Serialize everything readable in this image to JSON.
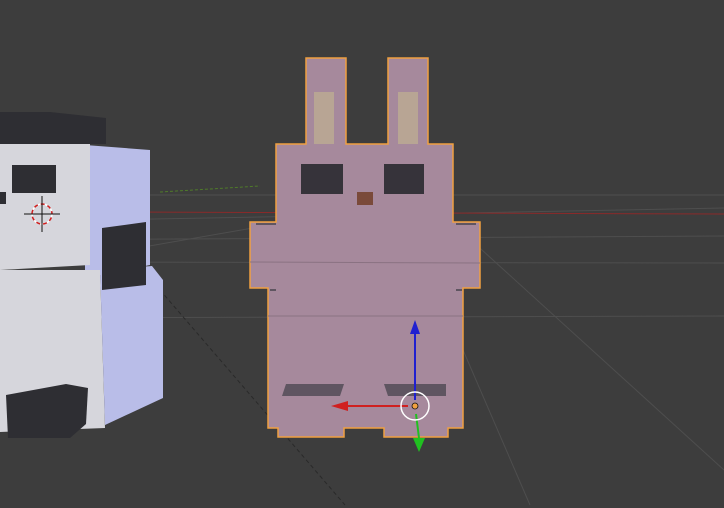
{
  "app": {
    "kind": "3d-viewport"
  },
  "viewport": {
    "background": "#3d3d3d",
    "grid_line_color": "#4e4e4e",
    "x_axis_color": "#8a2a2a",
    "y_axis_color": "#5a8a2a"
  },
  "objects": [
    {
      "name": "panda-block-character",
      "selected": false,
      "colors": {
        "body": "#d6d6dc",
        "side": "#b9bde8",
        "dark": "#2e2e33"
      }
    },
    {
      "name": "bunny-block-character",
      "selected": true,
      "colors": {
        "body": "#a6899c",
        "ear_inner": "#b8a594",
        "eye": "#36333a",
        "nose": "#7a4a3a",
        "outline": "#f0a040",
        "foot": "#5f5561"
      }
    }
  ],
  "cursor_3d": {
    "colors": {
      "ring_a": "#ffffff",
      "ring_b": "#d02020"
    }
  },
  "transform_gizmo": {
    "axes": [
      "x",
      "y",
      "z"
    ],
    "colors": {
      "x": "#d02020",
      "y": "#20c020",
      "z": "#2020d0",
      "center": "#ffffff"
    }
  }
}
